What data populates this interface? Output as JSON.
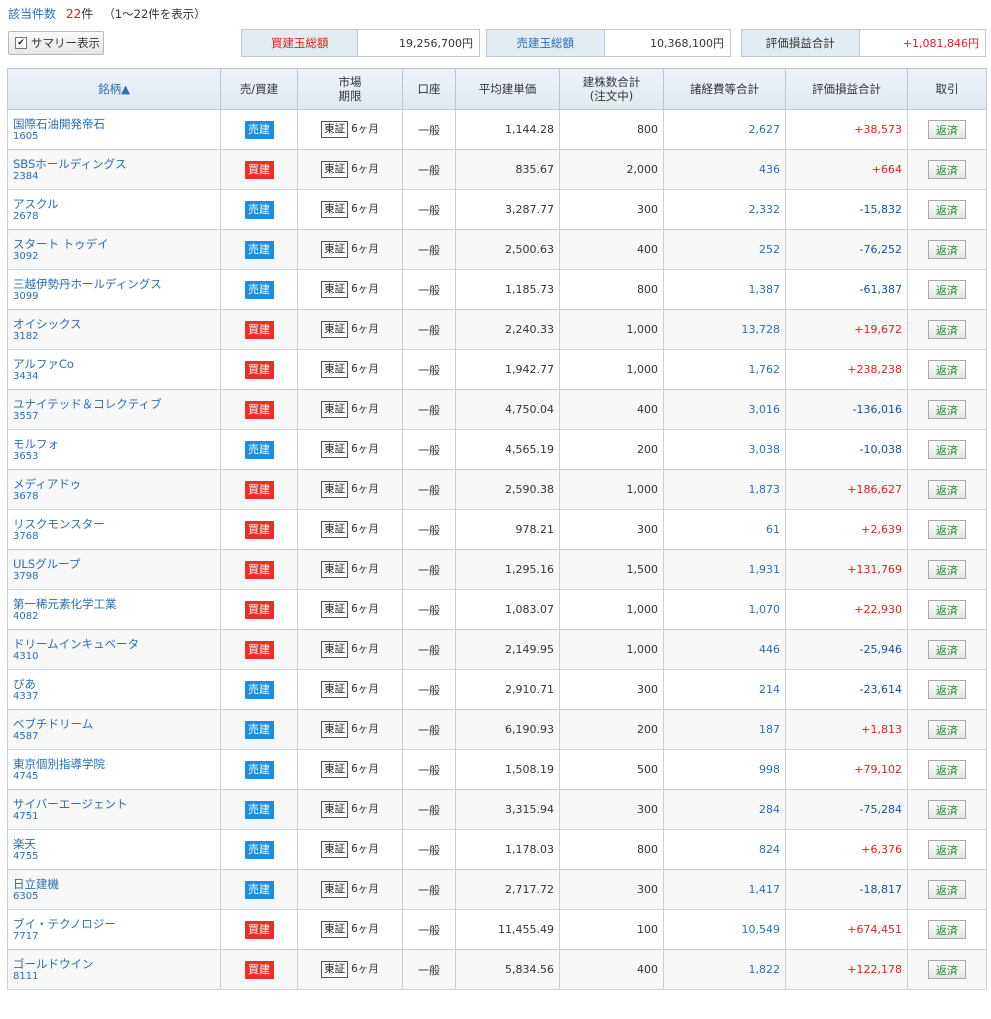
{
  "header": {
    "count_label": "該当件数",
    "count_value": "22",
    "count_unit": "件",
    "range_text": "（1〜22件を表示）",
    "summary_toggle_label": "サマリー表示",
    "summary_checked_mark": "✔"
  },
  "summary": {
    "buy_label": "買建玉総額",
    "buy_value": "19,256,700円",
    "sell_label": "売建玉総額",
    "sell_value": "10,368,100円",
    "pl_label": "評価損益合計",
    "pl_value": "+1,081,846円",
    "colors": {
      "buy_label": "#e0211b",
      "sell_label": "#2a6fb5",
      "profit": "#e0211b",
      "loss": "#16509c"
    }
  },
  "table": {
    "headers": {
      "name": "銘柄▲",
      "side": "売/買建",
      "market_line1": "市場",
      "market_line2": "期限",
      "account": "口座",
      "avg_price": "平均建単価",
      "qty_line1": "建株数合計",
      "qty_line2": "(注文中)",
      "fees": "諸経費等合計",
      "pl": "評価損益合計",
      "trade": "取引"
    },
    "rows": [
      {
        "name": "国際石油開発帝石",
        "code": "1605",
        "side": "売建",
        "sell": true,
        "market": "東証",
        "period": "6ヶ月",
        "account": "一般",
        "avg": "1,144.28",
        "qty": "800",
        "fees": "2,627",
        "pl": "+38,573",
        "action": "返済"
      },
      {
        "name": "SBSホールディングス",
        "code": "2384",
        "side": "買建",
        "sell": false,
        "market": "東証",
        "period": "6ヶ月",
        "account": "一般",
        "avg": "835.67",
        "qty": "2,000",
        "fees": "436",
        "pl": "+664",
        "action": "返済"
      },
      {
        "name": "アスクル",
        "code": "2678",
        "side": "売建",
        "sell": true,
        "market": "東証",
        "period": "6ヶ月",
        "account": "一般",
        "avg": "3,287.77",
        "qty": "300",
        "fees": "2,332",
        "pl": "-15,832",
        "action": "返済"
      },
      {
        "name": "スタート トゥデイ",
        "code": "3092",
        "side": "売建",
        "sell": true,
        "market": "東証",
        "period": "6ヶ月",
        "account": "一般",
        "avg": "2,500.63",
        "qty": "400",
        "fees": "252",
        "pl": "-76,252",
        "action": "返済"
      },
      {
        "name": "三越伊勢丹ホールディングス",
        "code": "3099",
        "side": "売建",
        "sell": true,
        "market": "東証",
        "period": "6ヶ月",
        "account": "一般",
        "avg": "1,185.73",
        "qty": "800",
        "fees": "1,387",
        "pl": "-61,387",
        "action": "返済"
      },
      {
        "name": "オイシックス",
        "code": "3182",
        "side": "買建",
        "sell": false,
        "market": "東証",
        "period": "6ヶ月",
        "account": "一般",
        "avg": "2,240.33",
        "qty": "1,000",
        "fees": "13,728",
        "pl": "+19,672",
        "action": "返済"
      },
      {
        "name": "アルファCo",
        "code": "3434",
        "side": "買建",
        "sell": false,
        "market": "東証",
        "period": "6ヶ月",
        "account": "一般",
        "avg": "1,942.77",
        "qty": "1,000",
        "fees": "1,762",
        "pl": "+238,238",
        "action": "返済"
      },
      {
        "name": "ユナイテッド＆コレクティブ",
        "code": "3557",
        "side": "買建",
        "sell": false,
        "market": "東証",
        "period": "6ヶ月",
        "account": "一般",
        "avg": "4,750.04",
        "qty": "400",
        "fees": "3,016",
        "pl": "-136,016",
        "action": "返済"
      },
      {
        "name": "モルフォ",
        "code": "3653",
        "side": "売建",
        "sell": true,
        "market": "東証",
        "period": "6ヶ月",
        "account": "一般",
        "avg": "4,565.19",
        "qty": "200",
        "fees": "3,038",
        "pl": "-10,038",
        "action": "返済"
      },
      {
        "name": "メディアドゥ",
        "code": "3678",
        "side": "買建",
        "sell": false,
        "market": "東証",
        "period": "6ヶ月",
        "account": "一般",
        "avg": "2,590.38",
        "qty": "1,000",
        "fees": "1,873",
        "pl": "+186,627",
        "action": "返済"
      },
      {
        "name": "リスクモンスター",
        "code": "3768",
        "side": "買建",
        "sell": false,
        "market": "東証",
        "period": "6ヶ月",
        "account": "一般",
        "avg": "978.21",
        "qty": "300",
        "fees": "61",
        "pl": "+2,639",
        "action": "返済"
      },
      {
        "name": "ULSグループ",
        "code": "3798",
        "side": "買建",
        "sell": false,
        "market": "東証",
        "period": "6ヶ月",
        "account": "一般",
        "avg": "1,295.16",
        "qty": "1,500",
        "fees": "1,931",
        "pl": "+131,769",
        "action": "返済"
      },
      {
        "name": "第一稀元素化学工業",
        "code": "4082",
        "side": "買建",
        "sell": false,
        "market": "東証",
        "period": "6ヶ月",
        "account": "一般",
        "avg": "1,083.07",
        "qty": "1,000",
        "fees": "1,070",
        "pl": "+22,930",
        "action": "返済"
      },
      {
        "name": "ドリームインキュベータ",
        "code": "4310",
        "side": "買建",
        "sell": false,
        "market": "東証",
        "period": "6ヶ月",
        "account": "一般",
        "avg": "2,149.95",
        "qty": "1,000",
        "fees": "446",
        "pl": "-25,946",
        "action": "返済"
      },
      {
        "name": "ぴあ",
        "code": "4337",
        "side": "売建",
        "sell": true,
        "market": "東証",
        "period": "6ヶ月",
        "account": "一般",
        "avg": "2,910.71",
        "qty": "300",
        "fees": "214",
        "pl": "-23,614",
        "action": "返済"
      },
      {
        "name": "ベブチドリーム",
        "code": "4587",
        "side": "売建",
        "sell": true,
        "market": "東証",
        "period": "6ヶ月",
        "account": "一般",
        "avg": "6,190.93",
        "qty": "200",
        "fees": "187",
        "pl": "+1,813",
        "action": "返済"
      },
      {
        "name": "東京個別指導学院",
        "code": "4745",
        "side": "売建",
        "sell": true,
        "market": "東証",
        "period": "6ヶ月",
        "account": "一般",
        "avg": "1,508.19",
        "qty": "500",
        "fees": "998",
        "pl": "+79,102",
        "action": "返済"
      },
      {
        "name": "サイバーエージェント",
        "code": "4751",
        "side": "売建",
        "sell": true,
        "market": "東証",
        "period": "6ヶ月",
        "account": "一般",
        "avg": "3,315.94",
        "qty": "300",
        "fees": "284",
        "pl": "-75,284",
        "action": "返済"
      },
      {
        "name": "楽天",
        "code": "4755",
        "side": "売建",
        "sell": true,
        "market": "東証",
        "period": "6ヶ月",
        "account": "一般",
        "avg": "1,178.03",
        "qty": "800",
        "fees": "824",
        "pl": "+6,376",
        "action": "返済"
      },
      {
        "name": "日立建機",
        "code": "6305",
        "side": "売建",
        "sell": true,
        "market": "東証",
        "period": "6ヶ月",
        "account": "一般",
        "avg": "2,717.72",
        "qty": "300",
        "fees": "1,417",
        "pl": "-18,817",
        "action": "返済"
      },
      {
        "name": "ブイ・テクノロジー",
        "code": "7717",
        "side": "買建",
        "sell": false,
        "market": "東証",
        "period": "6ヶ月",
        "account": "一般",
        "avg": "11,455.49",
        "qty": "100",
        "fees": "10,549",
        "pl": "+674,451",
        "action": "返済"
      },
      {
        "name": "ゴールドウイン",
        "code": "8111",
        "side": "買建",
        "sell": false,
        "market": "東証",
        "period": "6ヶ月",
        "account": "一般",
        "avg": "5,834.56",
        "qty": "400",
        "fees": "1,822",
        "pl": "+122,178",
        "action": "返済"
      }
    ]
  }
}
